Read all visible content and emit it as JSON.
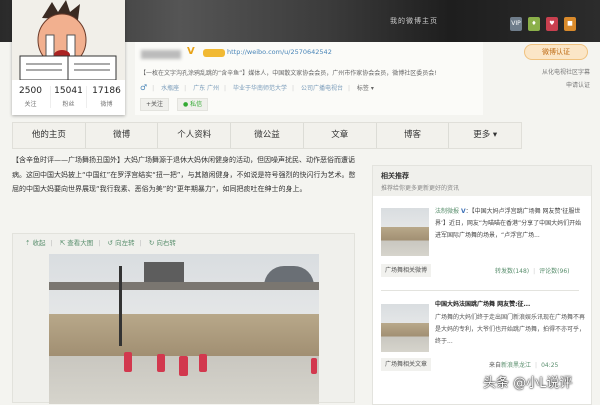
{
  "banner": {
    "text": "我的微博主页",
    "icons": [
      "vip-icon",
      "level-icon",
      "gift-icon",
      "medal-icon"
    ],
    "vip_label": "VIP"
  },
  "profile": {
    "url": "http://weibo.com/u/2570642542",
    "bio": "【一枚在文字沟孔涂鸦乱跳的“含辛鱼”】媒体人，中国散文家协会会员，广州市作家协会会员，微博社区委员会!",
    "gender": "♂",
    "meta": [
      "水瓶座",
      "广东 广州",
      "毕业于华南师范大学",
      "公司广播电视台",
      "标签 ▾"
    ],
    "follow_label": "+关注",
    "message_label": "● 私信",
    "stats": [
      {
        "value": "2500",
        "label": "关注"
      },
      {
        "value": "15041",
        "label": "粉丝"
      },
      {
        "value": "17186",
        "label": "微博"
      }
    ],
    "verify_label": "微博认证",
    "verify_desc": "从化电视社区字幕",
    "apply_label": "申请认证"
  },
  "nav": {
    "tabs": [
      "他的主页",
      "微博",
      "个人资料",
      "微公益",
      "文章",
      "博客",
      "更多 ▾"
    ]
  },
  "post": {
    "text": "【含辛鱼时评——广场舞扬丑国外】大妈广场舞源于退休大妈休闲健身的活动，但因噪声扰民、动作恶俗而遭诟病。这回中国大妈披上“中国红”在罗浮宫结实“扭一把”，与其随闲健身，不如说是符号强烈的快闪行为艺术。憋屈的中国大妈要向世界展现“我行我素、恶俗为美”的“更年期暴力”，如同把痰吐在绅士的身上。",
    "actions": [
      "⇡ 收起",
      "⇱ 查看大图",
      "↺ 向左转",
      "↻ 向右转"
    ]
  },
  "sidebar": {
    "title": "相关推荐",
    "subtitle": "推荐给你更多更新更好的资讯",
    "items": [
      {
        "author": "法制微报",
        "text": "：【中国大妈卢浮宫跳广场舞 网友赞‘征服世界’】近日，网友“为喵喵在香港”分享了中国大妈们开始进军国际广场舞的场景，“卢浮宫广场...",
        "tag": "广场舞相关微博",
        "reposts": "转发数(148)",
        "comments": "评论数(96)"
      },
      {
        "title": "中国大妈法国跳广场舞 网友赞:征...",
        "text": "广场舞的大妈们终于走出国门新浪娱乐讯现在广场舞不再是大妈的专利，大爷们也开始跳广场舞，拍得不亦可乎，终于...",
        "tag": "广场舞相关文章",
        "source_prefix": "来自",
        "source": "新浪黑龙江",
        "time": "04:25"
      }
    ]
  },
  "watermark": "头条 @小L说评",
  "colors": {
    "accent": "#e8a317",
    "link": "#4a86b8",
    "green": "#5a8f6e"
  }
}
